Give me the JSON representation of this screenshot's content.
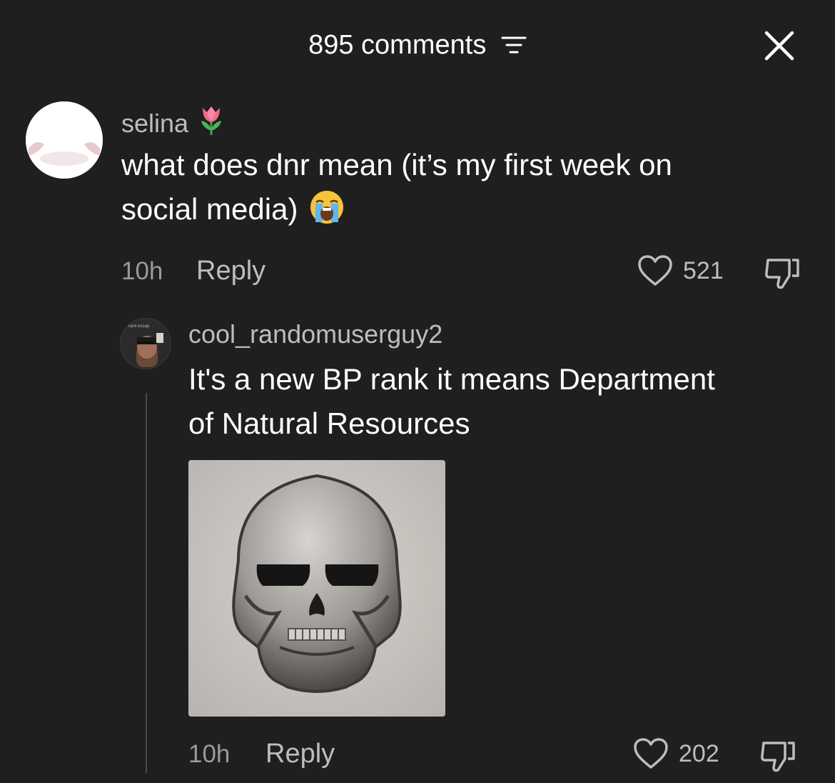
{
  "header": {
    "comment_count": "895 comments",
    "filter_icon": "filter-icon",
    "close_icon": "close-icon"
  },
  "comments": [
    {
      "username": "selina",
      "username_emoji": "tulip",
      "text_line1": "what does dnr mean (it’s my first week on",
      "text_line2": "social media)",
      "text_emoji": "loudly-crying-face",
      "time": "10h",
      "reply_label": "Reply",
      "likes": "521"
    },
    {
      "username": "cool_randomuserguy2",
      "avatar_caption": "i cant escap",
      "text_line1": "It's a new BP rank it means Department",
      "text_line2": "of Natural Resources",
      "image_icon": "skull-image",
      "time": "10h",
      "reply_label": "Reply",
      "likes": "202"
    }
  ],
  "colors": {
    "background": "#1f1f1f",
    "text": "#ffffff",
    "muted": "#bdbdbd",
    "time": "#9a9a9a"
  }
}
